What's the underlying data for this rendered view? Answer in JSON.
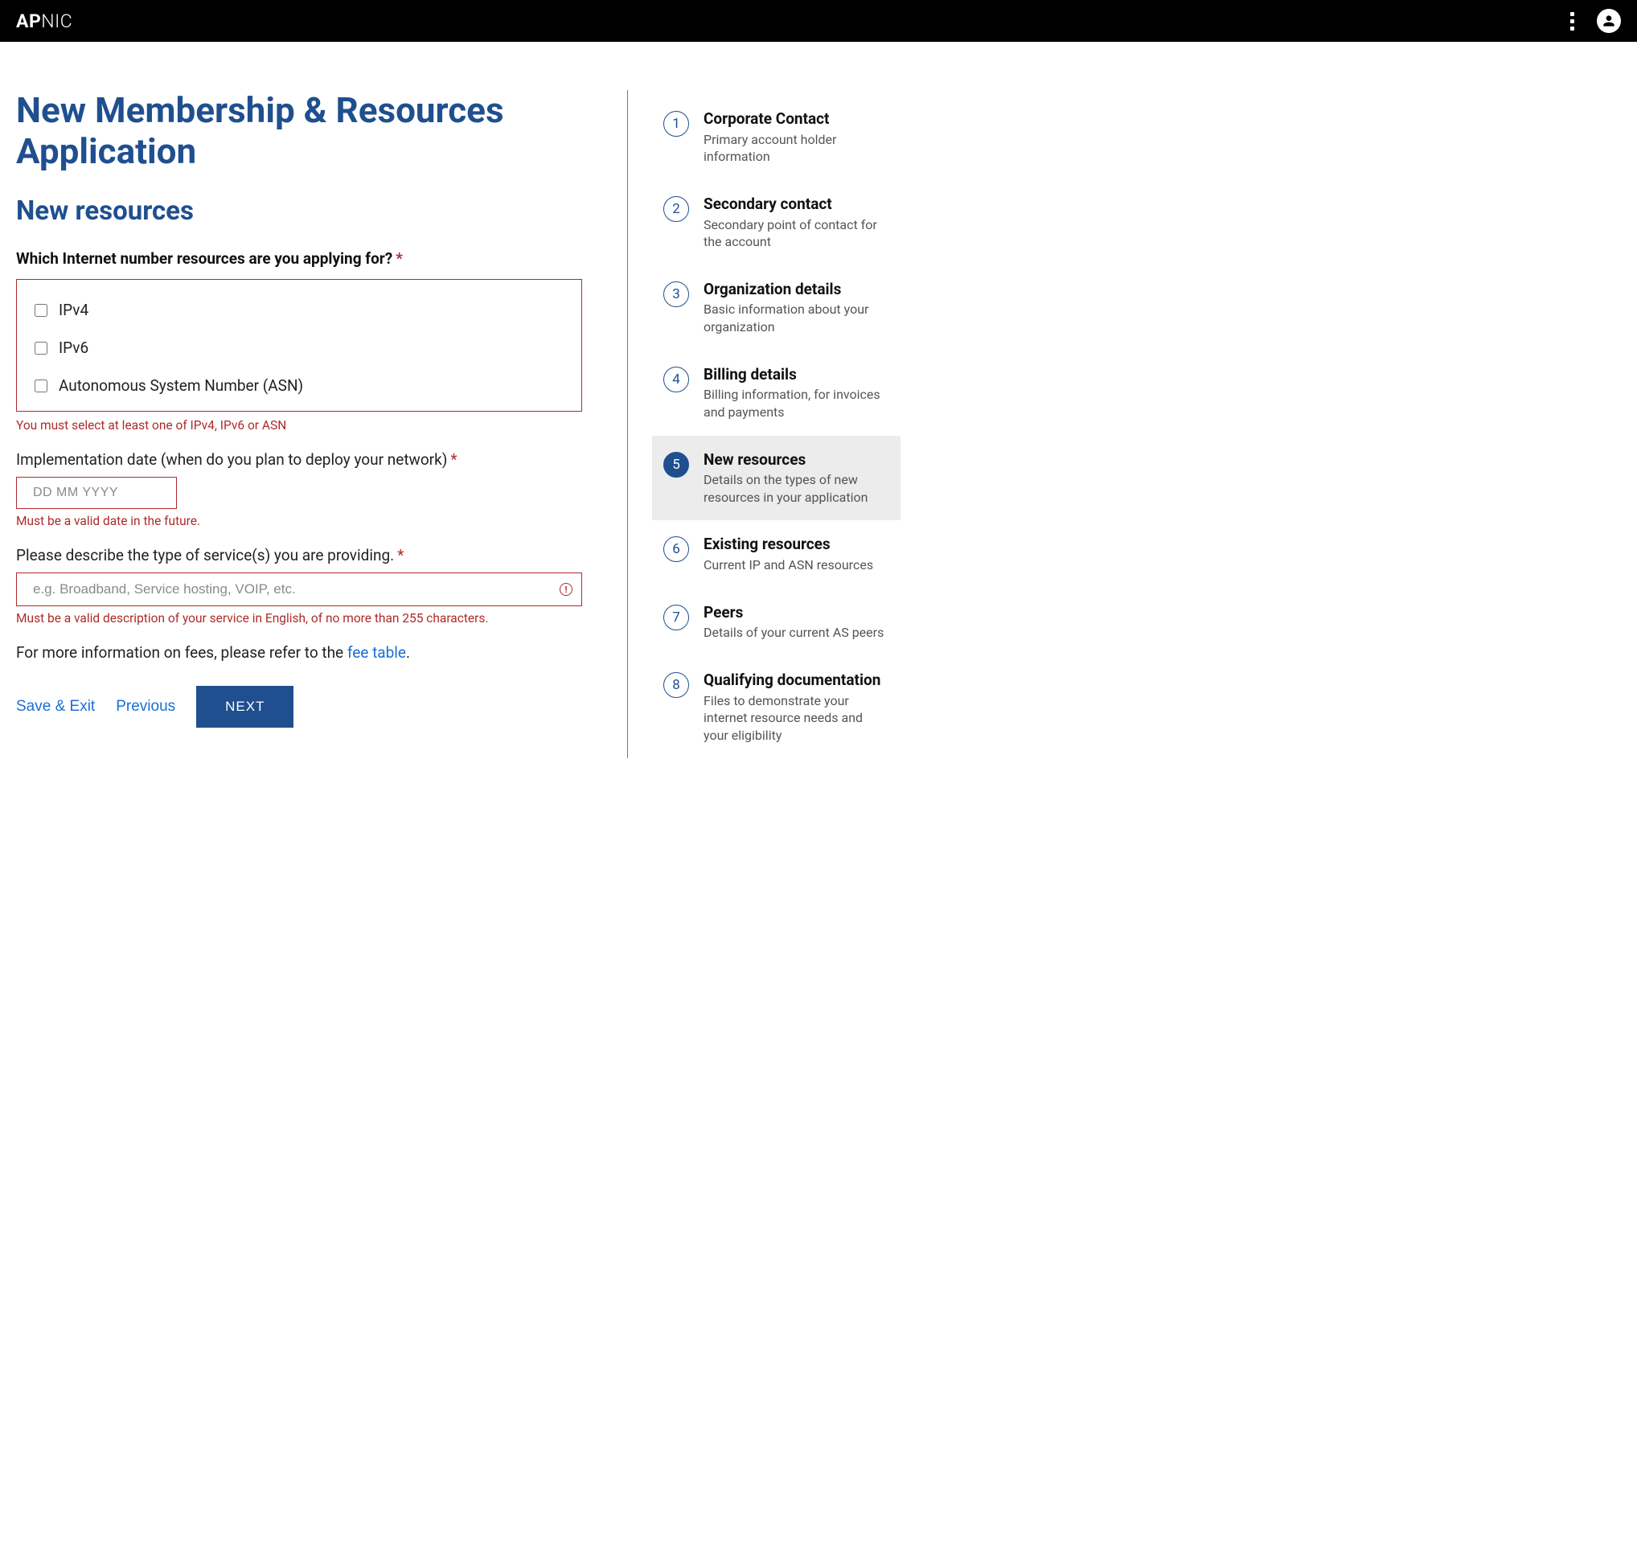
{
  "brand": {
    "bold": "AP",
    "thin": "NIC"
  },
  "page_title": "New Membership & Resources Application",
  "section_title": "New resources",
  "q1": {
    "label": "Which Internet number resources are you applying for?",
    "options": [
      "IPv4",
      "IPv6",
      "Autonomous System Number (ASN)"
    ],
    "error": "You must select at least one of IPv4, IPv6 or ASN"
  },
  "q2": {
    "label": "Implementation date (when do you plan to deploy your network)",
    "placeholder": "DD MM YYYY",
    "error": "Must be a valid date in the future."
  },
  "q3": {
    "label": "Please describe the type of service(s) you are providing.",
    "placeholder": "e.g. Broadband, Service hosting, VOIP, etc.",
    "error": "Must be a valid description of your service in English, of no more than 255 characters."
  },
  "info": {
    "prefix": "For more information on fees, please refer to the ",
    "link": "fee table",
    "suffix": "."
  },
  "buttons": {
    "save_exit": "Save & Exit",
    "previous": "Previous",
    "next": "NEXT"
  },
  "steps": [
    {
      "n": "1",
      "title": "Corporate Contact",
      "desc": "Primary account holder information",
      "active": false
    },
    {
      "n": "2",
      "title": "Secondary contact",
      "desc": "Secondary point of contact for the account",
      "active": false
    },
    {
      "n": "3",
      "title": "Organization details",
      "desc": "Basic information about your organization",
      "active": false
    },
    {
      "n": "4",
      "title": "Billing details",
      "desc": "Billing information, for invoices and payments",
      "active": false
    },
    {
      "n": "5",
      "title": "New resources",
      "desc": "Details on the types of new resources in your application",
      "active": true
    },
    {
      "n": "6",
      "title": "Existing resources",
      "desc": "Current IP and ASN resources",
      "active": false
    },
    {
      "n": "7",
      "title": "Peers",
      "desc": "Details of your current AS peers",
      "active": false
    },
    {
      "n": "8",
      "title": "Qualifying documentation",
      "desc": "Files to demonstrate your internet resource needs and your eligibility",
      "active": false
    }
  ]
}
